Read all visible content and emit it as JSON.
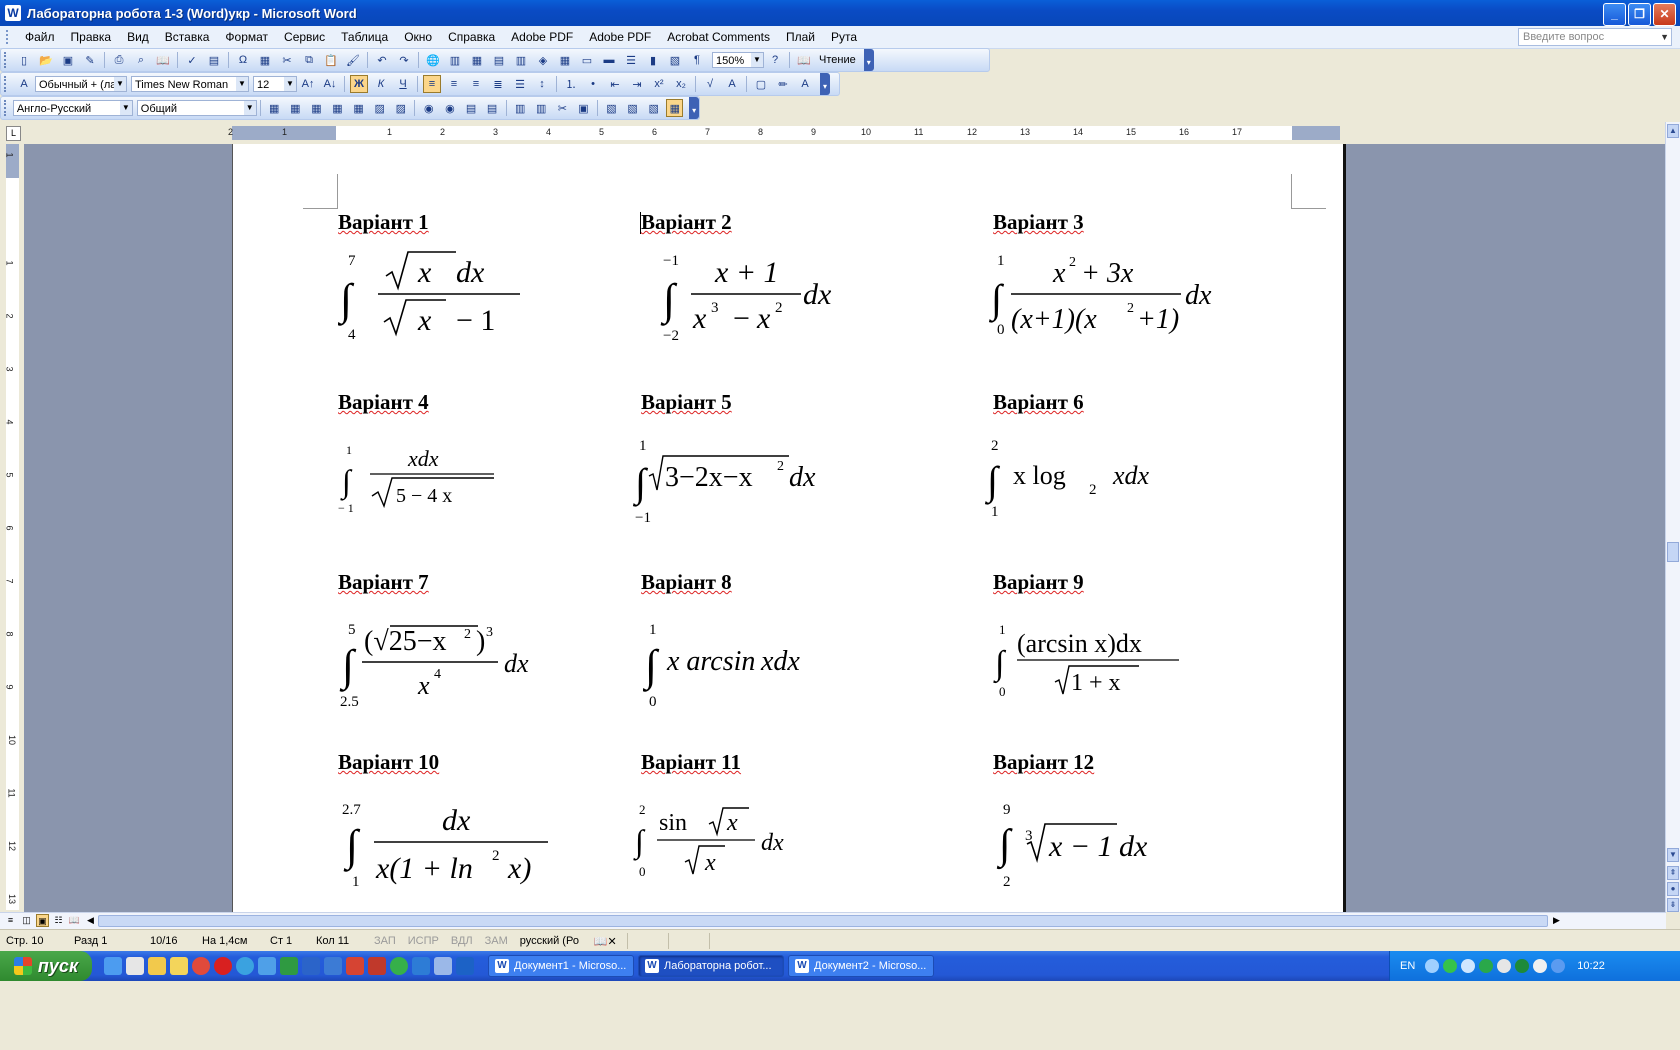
{
  "window": {
    "title": "Лабораторна робота 1-3 (Word)укр - Microsoft Word",
    "app_icon": "W"
  },
  "menu": {
    "items": [
      "Файл",
      "Правка",
      "Вид",
      "Вставка",
      "Формат",
      "Сервис",
      "Таблица",
      "Окно",
      "Справка",
      "Adobe PDF",
      "Adobe PDF",
      "Acrobat Comments",
      "Плай",
      "Рута"
    ],
    "ask_placeholder": "Введите вопрос"
  },
  "toolbar_standard": {
    "zoom": "150%",
    "reading_label": "Чтение"
  },
  "toolbar_format": {
    "style": "Обычный + (ла",
    "font": "Times New Roman",
    "size": "12",
    "bold_label": "Ж",
    "italic_label": "К",
    "underline_label": "Ч"
  },
  "toolbar_translate": {
    "dictionary": "Англо-Русский",
    "topic": "Общий"
  },
  "ruler": {
    "h_numbers": [
      "2",
      "1",
      "1",
      "2",
      "3",
      "4",
      "5",
      "6",
      "7",
      "8",
      "9",
      "10",
      "11",
      "12",
      "13",
      "14",
      "15",
      "16",
      "17"
    ],
    "v_numbers": [
      "1",
      "1",
      "2",
      "3",
      "4",
      "5",
      "6",
      "7",
      "8",
      "9",
      "10",
      "11",
      "12",
      "13"
    ]
  },
  "document": {
    "variants": [
      "Варіант 1",
      "Варіант 2",
      "Варіант 3",
      "Варіант 4",
      "Варіант 5",
      "Варіант 6",
      "Варіант 7",
      "Варіант 8",
      "Варіант 9",
      "Варіант 10",
      "Варіант 11",
      "Варіант 12"
    ],
    "formulas": {
      "f1": {
        "upper": "7",
        "lower": "4",
        "num": "x",
        "num_tail": "dx",
        "den": "x",
        "den_tail": "−  1"
      },
      "f2": {
        "upper": "−1",
        "lower": "−2",
        "num": "x + 1",
        "den_a": "x",
        "den_a_exp": "3",
        "den_op": "−",
        "den_b": "x",
        "den_b_exp": "2",
        "tail": "dx"
      },
      "f3": {
        "upper": "1",
        "lower": "0",
        "num_a": "x",
        "num_a_exp": "2",
        "num_rest": "+ 3x",
        "den_a": "(x+1)(x",
        "den_exp": "2",
        "den_b": "+1)",
        "tail": "dx"
      },
      "f4": {
        "upper": "1",
        "lower": "− 1",
        "num": "xdx",
        "den": "5  −  4  x"
      },
      "f5": {
        "upper": "1",
        "lower": "−1",
        "rad": "3−2x−x",
        "rad_exp": "2",
        "tail": "dx"
      },
      "f6": {
        "upper": "2",
        "lower": "1",
        "body": "x  log",
        "sub": "2",
        "tail": "xdx"
      },
      "f7": {
        "upper": "5",
        "lower": "2.5",
        "num": "(√25−x",
        "num_exp": "2",
        "num_close": ")",
        "num_pow": "3",
        "den": "x",
        "den_exp": "4",
        "tail": "dx"
      },
      "f8": {
        "upper": "1",
        "lower": "0",
        "body": "x arcsin",
        "tail": "xdx"
      },
      "f9": {
        "upper": "1",
        "lower": "0",
        "num": "(arcsin   x)dx",
        "den": "1 + x"
      },
      "f10": {
        "upper": "2.7",
        "lower": "1",
        "num": "dx",
        "den": "x(1 + ln",
        "den_exp": "2",
        "den_tail": "x)"
      },
      "f11": {
        "upper": "2",
        "lower": "0",
        "num": "sin",
        "num_rad": "x",
        "den": "x",
        "tail": "dx"
      },
      "f12": {
        "upper": "9",
        "lower": "2",
        "root_index": "3",
        "rad": "x  − 1",
        "tail": "dx"
      }
    }
  },
  "status": {
    "page": "Стр. 10",
    "section": "Разд  1",
    "pages": "10/16",
    "at": "На 1,4см",
    "line": "Ст  1",
    "col": "Кол  11",
    "rec": "ЗАП",
    "trk": "ИСПР",
    "ext": "ВДЛ",
    "ovr": "ЗАМ",
    "lang": "русский (Ро"
  },
  "taskbar": {
    "start_label": "пуск",
    "tasks": [
      "Документ1 - Microso...",
      "Лабораторна робот...",
      "Документ2 - Microso..."
    ],
    "active_task": 1,
    "lang": "EN",
    "clock": "10:22"
  },
  "colors": {
    "titlebar": "#0a4bc4",
    "doc_background": "#8a95ad",
    "spell_underline": "#d22"
  }
}
